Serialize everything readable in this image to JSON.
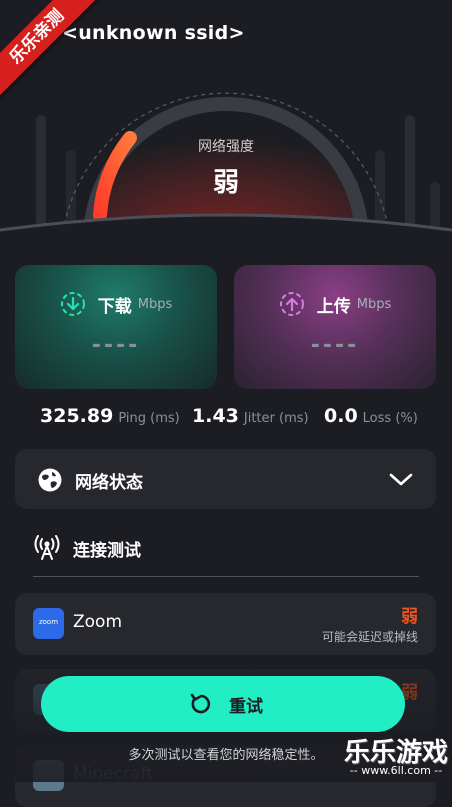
{
  "header": {
    "ssid": "<unknown ssid>",
    "corner_badge": "乐乐亲测"
  },
  "gauge": {
    "title": "网络强度",
    "value": "弱",
    "accent_color": "#f4553a"
  },
  "cards": {
    "download": {
      "label": "下载",
      "unit": "Mbps",
      "value": "----",
      "color": "#21e3b8"
    },
    "upload": {
      "label": "上传",
      "unit": "Mbps",
      "value": "----",
      "color": "#d97ae0"
    }
  },
  "stats": [
    {
      "value": "325.89",
      "label": "Ping (ms)"
    },
    {
      "value": "1.43",
      "label": "Jitter (ms)"
    },
    {
      "value": "0.0",
      "label": "Loss (%)"
    }
  ],
  "network_status": {
    "label": "网络状态",
    "icon": "globe-icon",
    "expand_icon": "chevron-down-icon"
  },
  "connection_test": {
    "label": "连接测试",
    "icon": "antenna-icon"
  },
  "apps": [
    {
      "name": "Zoom",
      "icon_text": "zoom",
      "level": "弱",
      "note": "可能会延迟或掉线"
    },
    {
      "name": "",
      "icon_text": "",
      "level": "弱",
      "note": ""
    },
    {
      "name": "Minecraft",
      "icon_text": "",
      "level": "",
      "note": ""
    }
  ],
  "retry": {
    "label": "重试",
    "icon": "refresh-icon",
    "color": "#21eec4"
  },
  "hint": "多次测试以查看您的网络稳定性。",
  "watermark": {
    "title": "乐乐游戏",
    "url": "-- www.6ll.com --"
  }
}
